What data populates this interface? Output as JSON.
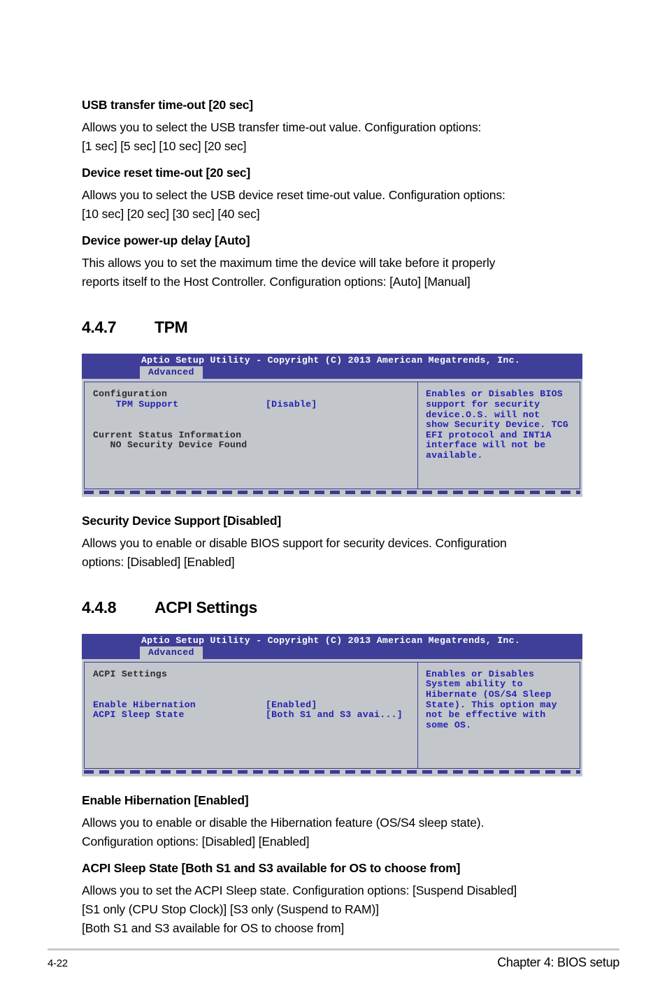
{
  "page": {
    "footer_page_number": "4-22",
    "footer_chapter": "Chapter 4: BIOS setup"
  },
  "items": [
    {
      "heading": "USB transfer time-out [20 sec]",
      "body_lines": [
        "Allows you to select the USB transfer time-out value. Configuration options:",
        "[1 sec] [5 sec]  [10 sec] [20 sec]"
      ]
    },
    {
      "heading": "Device reset time-out [20 sec]",
      "body_lines": [
        "Allows you to select the USB device reset time-out value. Configuration options:",
        "[10 sec] [20 sec] [30 sec] [40 sec]"
      ]
    },
    {
      "heading": "Device power-up delay [Auto]",
      "body_lines": [
        "This allows you to set the maximum time the device will take before it properly",
        "reports itself to the Host Controller. Configuration options: [Auto] [Manual]"
      ]
    }
  ],
  "section_tpm": {
    "number": "4.4.7",
    "title": "TPM",
    "bios": {
      "title": "Aptio Setup Utility - Copyright (C) 2013 American Megatrends, Inc.",
      "tab": "Advanced",
      "left_lines": [
        {
          "text": "Configuration",
          "style": "dark"
        },
        {
          "text": "    TPM Support",
          "value": "[Disable]",
          "style": "row"
        },
        {
          "text": "",
          "style": "blank"
        },
        {
          "text": "",
          "style": "blank"
        },
        {
          "text": "Current Status Information",
          "style": "dark"
        },
        {
          "text": "   NO Security Device Found",
          "style": "dark"
        }
      ],
      "help_lines": [
        "Enables or Disables BIOS",
        "support for security",
        "device.O.S. will not",
        "show Security Device. TCG",
        "EFI protocol and INT1A",
        "interface will not be",
        "available."
      ]
    },
    "after_items": [
      {
        "heading": "Security Device Support [Disabled]",
        "body_lines": [
          "Allows you to enable or disable BIOS support for security devices. Configuration",
          "options: [Disabled] [Enabled]"
        ]
      }
    ]
  },
  "section_acpi": {
    "number": "4.4.8",
    "title": "ACPI Settings",
    "bios": {
      "title": "Aptio Setup Utility - Copyright (C) 2013 American Megatrends, Inc.",
      "tab": "Advanced",
      "left_lines": [
        {
          "text": "ACPI Settings",
          "style": "dark"
        },
        {
          "text": "",
          "style": "blank"
        },
        {
          "text": "",
          "style": "blank"
        },
        {
          "text": "Enable Hibernation",
          "value": "[Enabled]",
          "style": "row"
        },
        {
          "text": "ACPI Sleep State",
          "value": "[Both S1 and S3 avai...]",
          "style": "row"
        },
        {
          "text": "",
          "style": "blank"
        },
        {
          "text": "",
          "style": "blank"
        },
        {
          "text": "",
          "style": "blank"
        }
      ],
      "help_lines": [
        "Enables or Disables",
        "System ability to",
        "Hibernate (OS/S4 Sleep",
        "State). This option may",
        "not be effective with",
        "some OS."
      ]
    },
    "after_items": [
      {
        "heading": "Enable Hibernation [Enabled]",
        "body_lines": [
          "Allows you to enable or disable the Hibernation feature (OS/S4 sleep state).",
          "Configuration options: [Disabled] [Enabled]"
        ]
      },
      {
        "heading": "ACPI Sleep State [Both S1 and S3 available for OS to choose from]",
        "body_lines": [
          "Allows you to set the ACPI Sleep state. Configuration options: [Suspend Disabled]",
          "[S1 only (CPU Stop Clock)] [S3 only (Suspend to RAM)]",
          "[Both S1 and S3 available for OS to choose from]"
        ]
      }
    ]
  },
  "colors": {
    "bios_header_blue": "#3f3e98",
    "bios_body_gray": "#c3c6cb",
    "bios_text_blue": "#2222b0",
    "bios_text_dark": "#2a2a33",
    "bios_border": "#3b3b93"
  }
}
